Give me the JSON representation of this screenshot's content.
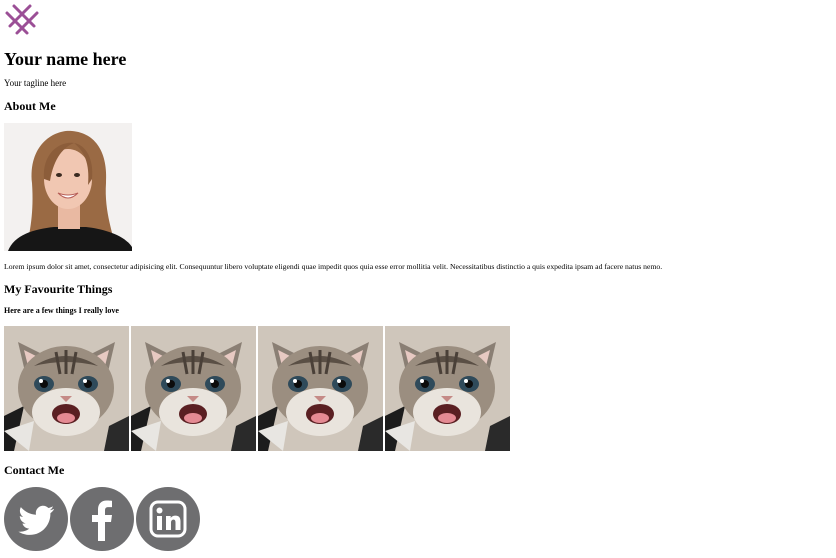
{
  "colors": {
    "logo": "#9b4f96",
    "social_bg": "#6e6e70",
    "social_glyph": "#ffffff"
  },
  "header": {
    "logo_icon": "cross-hatch-logo-icon",
    "name": "Your name here",
    "tagline": "Your tagline here"
  },
  "about": {
    "heading": "About Me",
    "text": "Lorem ipsum dolor sit amet, consectetur adipisicing elit. Consequuntur libero voluptate eligendi quae impedit quos quia esse error mollitia velit. Necessitatibus distinctio a quis expedita ipsam ad facere natus nemo."
  },
  "favourites": {
    "heading": "My Favourite Things",
    "subheading": "Here are a few things I really love",
    "images": [
      "kitten-photo",
      "kitten-photo",
      "kitten-photo",
      "kitten-photo"
    ]
  },
  "contact": {
    "heading": "Contact Me",
    "links": [
      "twitter-icon",
      "facebook-icon",
      "linkedin-icon"
    ]
  }
}
